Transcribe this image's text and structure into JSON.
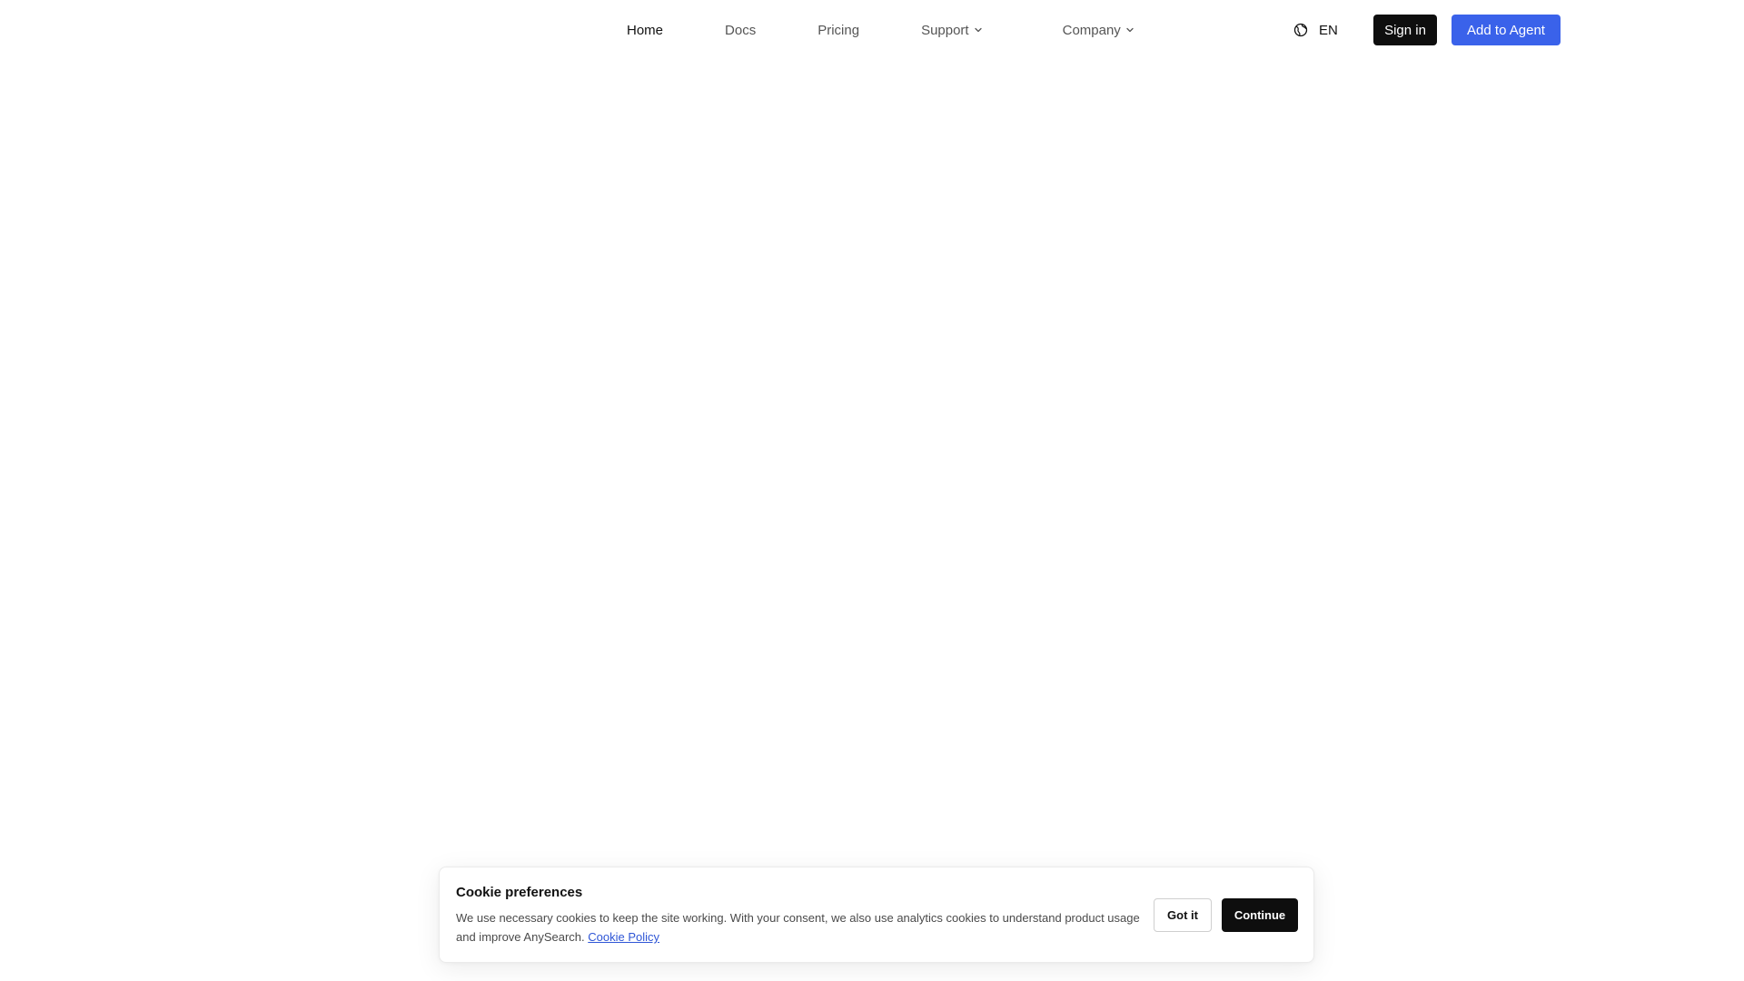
{
  "nav": {
    "items": [
      {
        "label": "Home",
        "active": true
      },
      {
        "label": "Docs"
      },
      {
        "label": "Pricing"
      },
      {
        "label": "Support",
        "has_dropdown": true
      },
      {
        "label": "Company",
        "has_dropdown": true
      }
    ],
    "language": "EN",
    "language_icon": "globe-icon",
    "signin_label": "Sign in",
    "cta_label": "Add to Agent"
  },
  "cookie": {
    "title": "Cookie preferences",
    "text": "We use necessary cookies to keep the site working. With your consent, we also use analytics cookies to understand product usage and improve AnySearch.",
    "link_label": "Cookie Policy",
    "got_it_label": "Got it",
    "continue_label": "Continue"
  },
  "colors": {
    "background": "#ffffff",
    "primary_dark": "#0e0e0e",
    "accent_blue": "#3a62ea",
    "link_blue": "#2f56d6",
    "nav_text": "#555555"
  }
}
